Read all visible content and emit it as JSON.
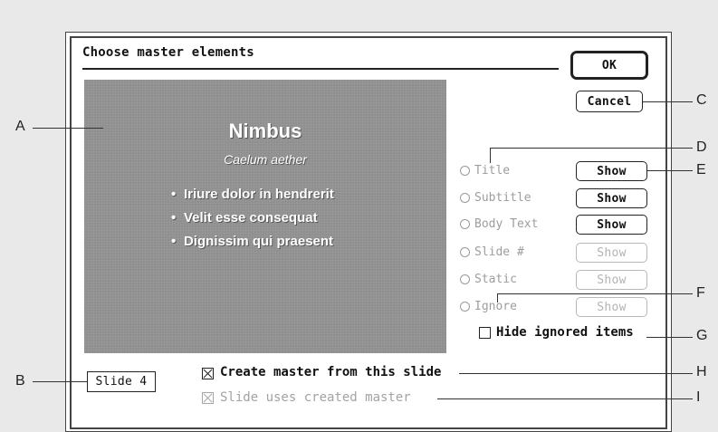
{
  "dialog": {
    "title": "Choose master elements",
    "ok_label": "OK",
    "cancel_label": "Cancel"
  },
  "preview": {
    "title": "Nimbus",
    "subtitle": "Caelum aether",
    "bullets": [
      "Iriure dolor in hendrerit",
      "Velit esse consequat",
      "Dignissim qui praesent"
    ]
  },
  "elements": [
    {
      "label": "Title",
      "button": "Show",
      "button_enabled": true
    },
    {
      "label": "Subtitle",
      "button": "Show",
      "button_enabled": true
    },
    {
      "label": "Body Text",
      "button": "Show",
      "button_enabled": true
    },
    {
      "label": "Slide #",
      "button": "Show",
      "button_enabled": false
    },
    {
      "label": "Static",
      "button": "Show",
      "button_enabled": false
    },
    {
      "label": "Ignore",
      "button": "Show",
      "button_enabled": false
    }
  ],
  "hide_ignored": {
    "label": "Hide ignored items",
    "checked": false
  },
  "slide_button_label": "Slide 4",
  "create_master": {
    "label": "Create master from this slide",
    "checked": true
  },
  "uses_master": {
    "label": "Slide uses created master",
    "checked": true,
    "enabled": false
  },
  "callouts": [
    "A",
    "B",
    "C",
    "D",
    "E",
    "F",
    "G",
    "H",
    "I"
  ]
}
